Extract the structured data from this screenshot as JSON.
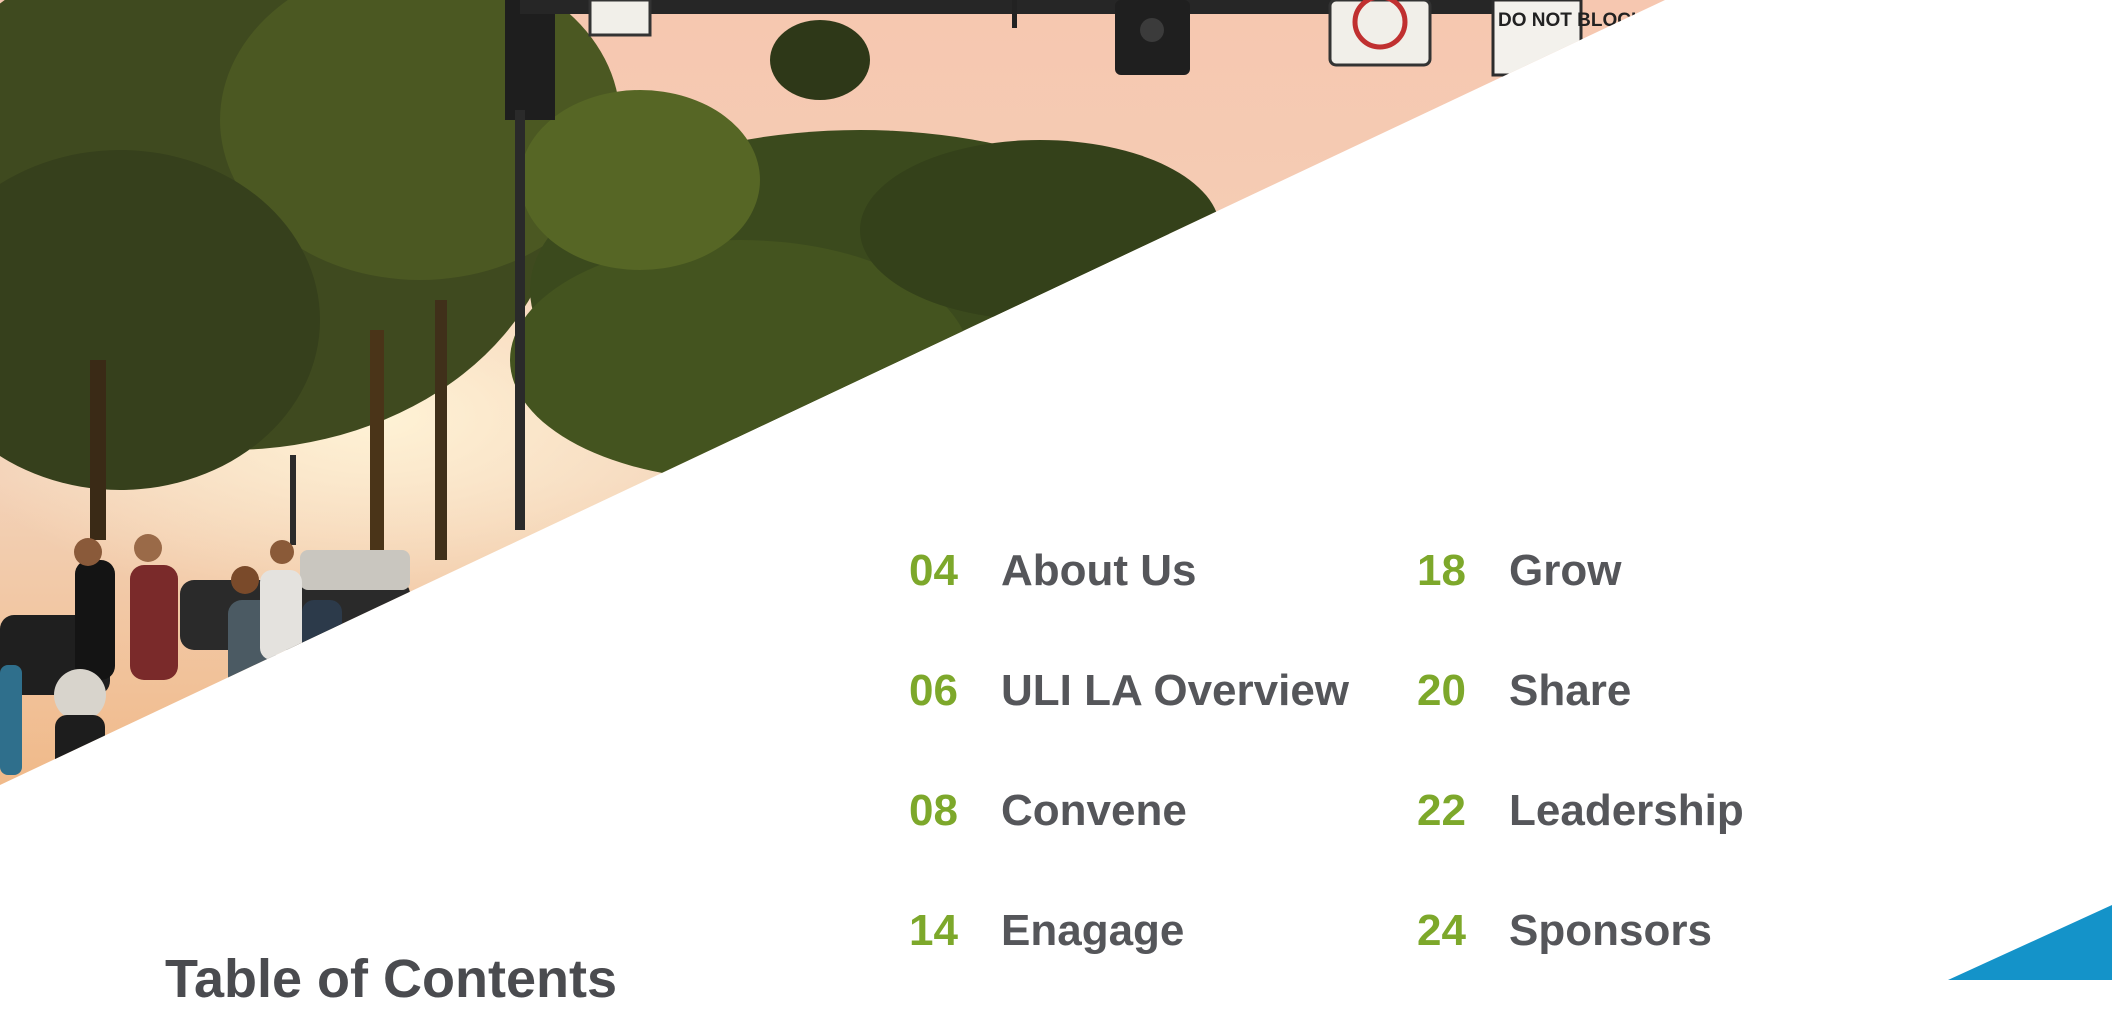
{
  "page": {
    "heading": "Table of Contents",
    "colors": {
      "number_green": "#7da82b",
      "label_gray": "#55565a",
      "accent_blue": "#1493c9"
    }
  },
  "photo": {
    "description": "street-scene-photo",
    "signs": {
      "do_not_block": "DO NOT BLOCK"
    }
  },
  "toc": {
    "left": [
      {
        "number": "04",
        "label": "About Us"
      },
      {
        "number": "06",
        "label": "ULI LA Overview"
      },
      {
        "number": "08",
        "label": "Convene"
      },
      {
        "number": "14",
        "label": "Enagage"
      }
    ],
    "right": [
      {
        "number": "18",
        "label": "Grow"
      },
      {
        "number": "20",
        "label": "Share"
      },
      {
        "number": "22",
        "label": "Leadership"
      },
      {
        "number": "24",
        "label": "Sponsors"
      }
    ]
  }
}
